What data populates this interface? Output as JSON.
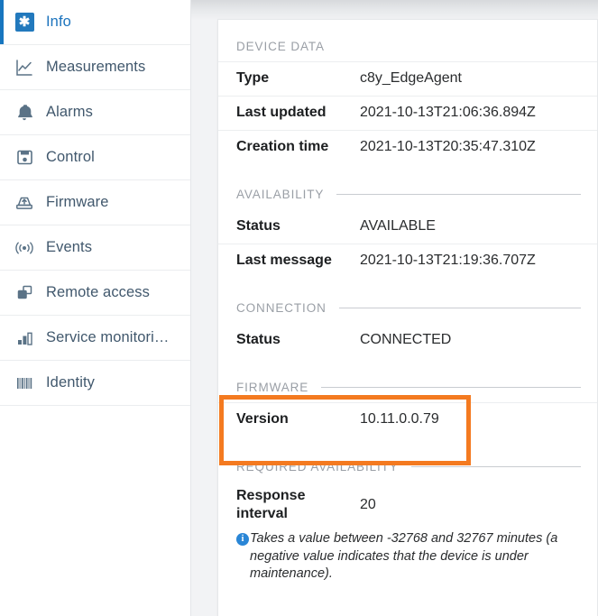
{
  "sidebar": {
    "items": [
      {
        "label": "Info",
        "icon": "info-asterisk-icon",
        "active": true
      },
      {
        "label": "Measurements",
        "icon": "chart-line-icon",
        "active": false
      },
      {
        "label": "Alarms",
        "icon": "bell-icon",
        "active": false
      },
      {
        "label": "Control",
        "icon": "floppy-disk-icon",
        "active": false
      },
      {
        "label": "Firmware",
        "icon": "firmware-upload-icon",
        "active": false
      },
      {
        "label": "Events",
        "icon": "broadcast-icon",
        "active": false
      },
      {
        "label": "Remote access",
        "icon": "windows-overlap-icon",
        "active": false
      },
      {
        "label": "Service monitori…",
        "icon": "bar-chart-icon",
        "active": false
      },
      {
        "label": "Identity",
        "icon": "barcode-icon",
        "active": false
      }
    ],
    "active_accent_color": "#1776bf",
    "active_text_color": "#1b73bd",
    "text_color": "#41586d"
  },
  "card": {
    "sections": [
      {
        "title": "DEVICE DATA",
        "rule": false,
        "rows": [
          {
            "label": "Type",
            "value": "c8y_EdgeAgent"
          },
          {
            "label": "Last updated",
            "value": "2021-10-13T21:06:36.894Z"
          },
          {
            "label": "Creation time",
            "value": "2021-10-13T20:35:47.310Z"
          }
        ]
      },
      {
        "title": "AVAILABILITY",
        "rule": true,
        "rows": [
          {
            "label": "Status",
            "value": "AVAILABLE"
          },
          {
            "label": "Last message",
            "value": "2021-10-13T21:19:36.707Z"
          }
        ]
      },
      {
        "title": "CONNECTION",
        "rule": true,
        "rows": [
          {
            "label": "Status",
            "value": "CONNECTED"
          }
        ]
      },
      {
        "title": "FIRMWARE",
        "rule": true,
        "rows": [
          {
            "label": "Version",
            "value": "10.11.0.0.79"
          }
        ]
      },
      {
        "title": "REQUIRED AVAILABILITY",
        "rule": true,
        "rows": [
          {
            "label": "Response interval",
            "value": "20"
          }
        ],
        "hint": {
          "icon": "info-circle-icon",
          "icon_glyph": "i",
          "text": "Takes a value between -32768 and 32767 minutes (a negative value indicates that the device is under maintenance)."
        }
      }
    ]
  },
  "annotation": {
    "highlight_color": "#f47a20",
    "target_section": "FIRMWARE"
  }
}
